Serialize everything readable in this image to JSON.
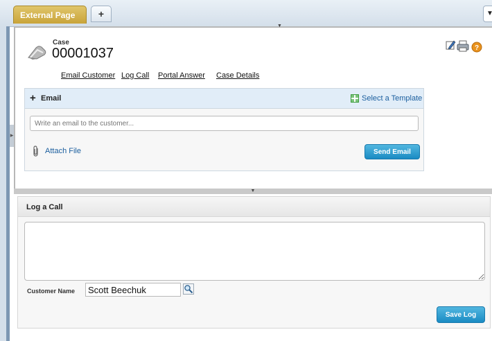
{
  "tabs": {
    "active_label": "External Page",
    "add_label": "+",
    "menu_glyph": "▼"
  },
  "case": {
    "label": "Case",
    "number": "00001037"
  },
  "case_links": [
    "Email Customer",
    "Log Call",
    "Portal Answer",
    "Case Details"
  ],
  "header_icons": [
    "edit-icon",
    "print-icon",
    "help-icon"
  ],
  "email": {
    "title": "Email",
    "template_link": "Select a Template",
    "placeholder": "Write an email to the customer...",
    "attach_label": "Attach File",
    "send_label": "Send Email"
  },
  "log_call": {
    "title": "Log a Call",
    "customer_label": "Customer Name",
    "customer_value": "Scott Beechuk",
    "save_label": "Save Log"
  },
  "colors": {
    "tab_gold": "#c9a43a",
    "link_blue": "#1a5e9e",
    "button_blue": "#1a8bc3"
  }
}
